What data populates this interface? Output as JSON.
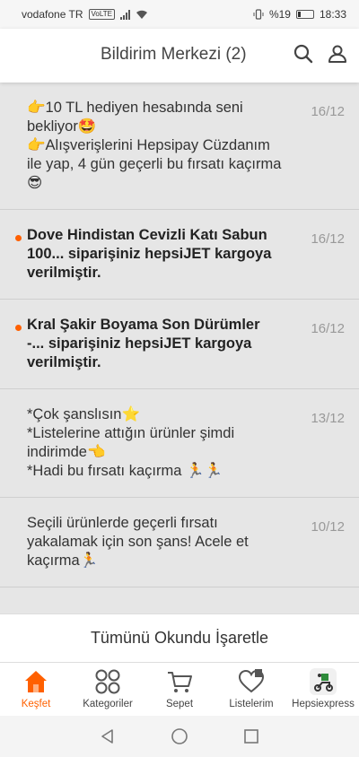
{
  "status_bar": {
    "carrier": "vodafone TR",
    "volte": "VoLTE",
    "battery": "%19",
    "time": "18:33"
  },
  "header": {
    "title": "Bildirim Merkezi (2)"
  },
  "notifications": [
    {
      "unread": false,
      "lines": [
        "👉10 TL hediyen hesabında seni",
        "bekliyor🤩",
        "👉Alışverişlerini Hepsipay Cüzdanım",
        "ile yap, 4 gün geçerli bu fırsatı kaçırma",
        "😎"
      ],
      "date": "16/12"
    },
    {
      "unread": true,
      "lines": [
        "Dove Hindistan Cevizli Katı Sabun",
        "100... siparişiniz hepsiJET kargoya",
        "verilmiştir."
      ],
      "date": "16/12"
    },
    {
      "unread": true,
      "lines": [
        "Kral Şakir Boyama Son Dürümler",
        "-... siparişiniz hepsiJET kargoya",
        "verilmiştir."
      ],
      "date": "16/12"
    },
    {
      "unread": false,
      "lines": [
        "*Çok şanslısın⭐",
        "*Listelerine attığın ürünler şimdi",
        "indirimde👈",
        "*Hadi bu fırsatı kaçırma 🏃🏃"
      ],
      "date": "13/12"
    },
    {
      "unread": false,
      "lines": [
        "Seçili ürünlerde geçerli fırsatı",
        "yakalamak için son şans! Acele et",
        "kaçırma🏃"
      ],
      "date": "10/12"
    }
  ],
  "mark_all_label": "Tümünü Okundu İşaretle",
  "tabs": [
    {
      "label": "Keşfet",
      "icon": "home-icon",
      "active": true
    },
    {
      "label": "Kategoriler",
      "icon": "categories-icon",
      "active": false
    },
    {
      "label": "Sepet",
      "icon": "cart-icon",
      "active": false
    },
    {
      "label": "Listelerim",
      "icon": "heart-list-icon",
      "active": false
    },
    {
      "label": "Hepsiexpress",
      "icon": "scooter-icon",
      "active": false
    }
  ],
  "colors": {
    "accent": "#ff6000",
    "unread_dot": "#ff6000"
  }
}
